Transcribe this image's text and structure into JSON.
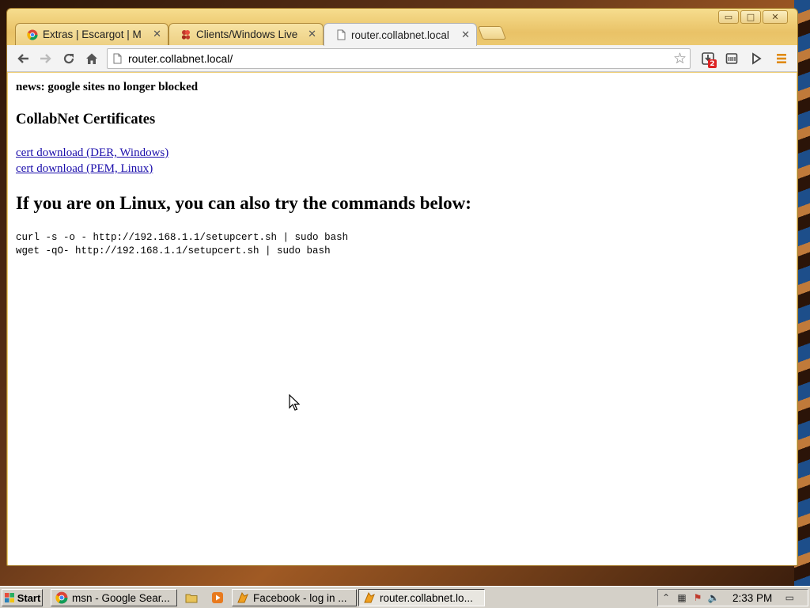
{
  "browser": {
    "tabs": [
      {
        "label": "Extras | Escargot | M",
        "icon": "chrome-icon"
      },
      {
        "label": "Clients/Windows Live",
        "icon": "msn-butterfly-icon"
      },
      {
        "label": "router.collabnet.local",
        "icon": "page-icon"
      }
    ],
    "address": "router.collabnet.local/",
    "downloads_badge": "2",
    "window_controls": {
      "minimize": "▭",
      "maximize": "□",
      "close": "✕"
    }
  },
  "page": {
    "news": "news: google sites no longer blocked",
    "cert_heading": "CollabNet Certificates",
    "links": [
      "cert download (DER, Windows)",
      "cert download (PEM, Linux)"
    ],
    "linux_heading": "If you are on Linux, you can also try the commands below:",
    "commands": [
      "curl -s -o - http://192.168.1.1/setupcert.sh | sudo bash",
      "wget -qO- http://192.168.1.1/setupcert.sh | sudo bash"
    ]
  },
  "taskbar": {
    "start_label": "Start",
    "tasks": [
      {
        "label": "msn - Google Sear...",
        "icon": "chrome-icon"
      },
      {
        "label": "Facebook - log in ...",
        "icon": "app-icon"
      },
      {
        "label": "router.collabnet.lo...",
        "icon": "app-icon"
      }
    ],
    "clock": "2:33 PM"
  },
  "colors": {
    "link": "#1a0dab",
    "window_frame": "#efcf78",
    "taskbar": "#d4d0c8"
  }
}
